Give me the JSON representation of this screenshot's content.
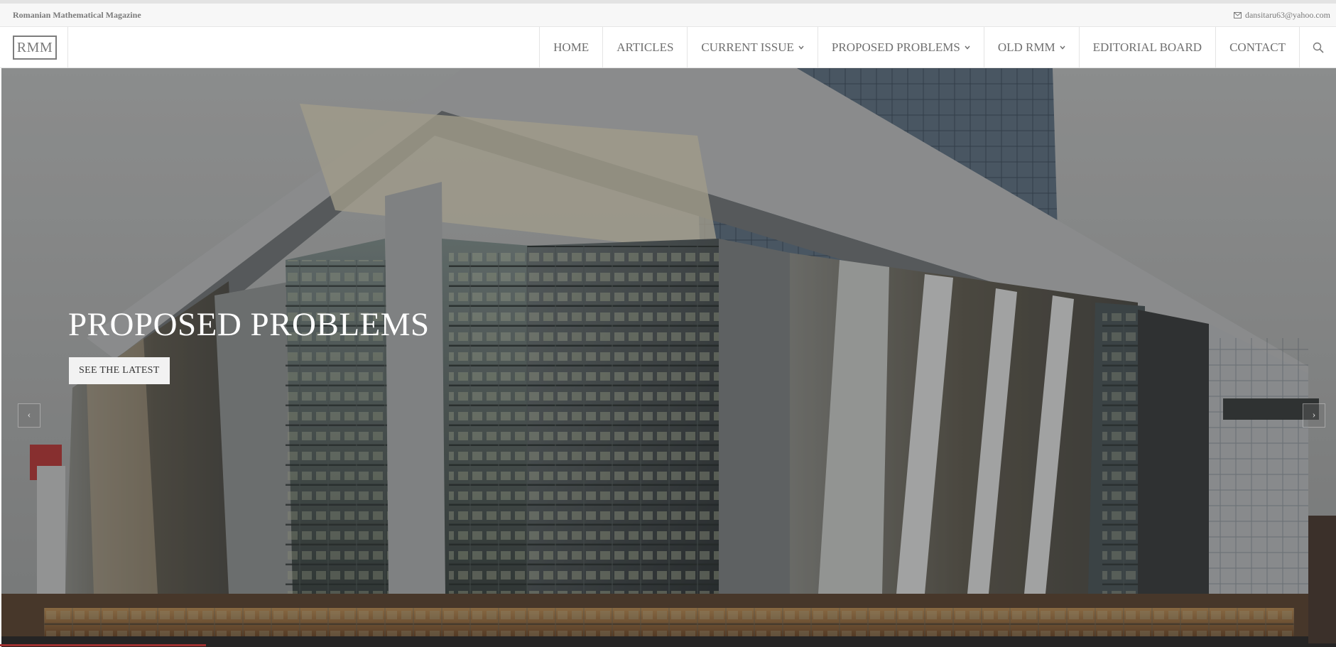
{
  "topbar": {
    "site_name": "Romanian Mathematical Magazine",
    "email": "dansitaru63@yahoo.com",
    "email_icon": "envelope-icon"
  },
  "header": {
    "logo_text": "RMM",
    "nav": [
      {
        "label": "HOME",
        "dropdown": false
      },
      {
        "label": "ARTICLES",
        "dropdown": false
      },
      {
        "label": "CURRENT ISSUE",
        "dropdown": true
      },
      {
        "label": "PROPOSED PROBLEMS",
        "dropdown": true
      },
      {
        "label": "OLD RMM",
        "dropdown": true
      },
      {
        "label": "EDITORIAL BOARD",
        "dropdown": false
      },
      {
        "label": "CONTACT",
        "dropdown": false
      }
    ],
    "search_icon": "search-icon"
  },
  "hero": {
    "title": "PROPOSED PROBLEMS",
    "button_label": "SEE THE LATEST",
    "prev_arrow": "‹",
    "next_arrow": "›"
  },
  "colors": {
    "nav_text": "#6f6f6f",
    "topbar_bg": "#f7f7f7",
    "hero_text": "#ffffff",
    "button_bg": "#f2f2f2"
  }
}
